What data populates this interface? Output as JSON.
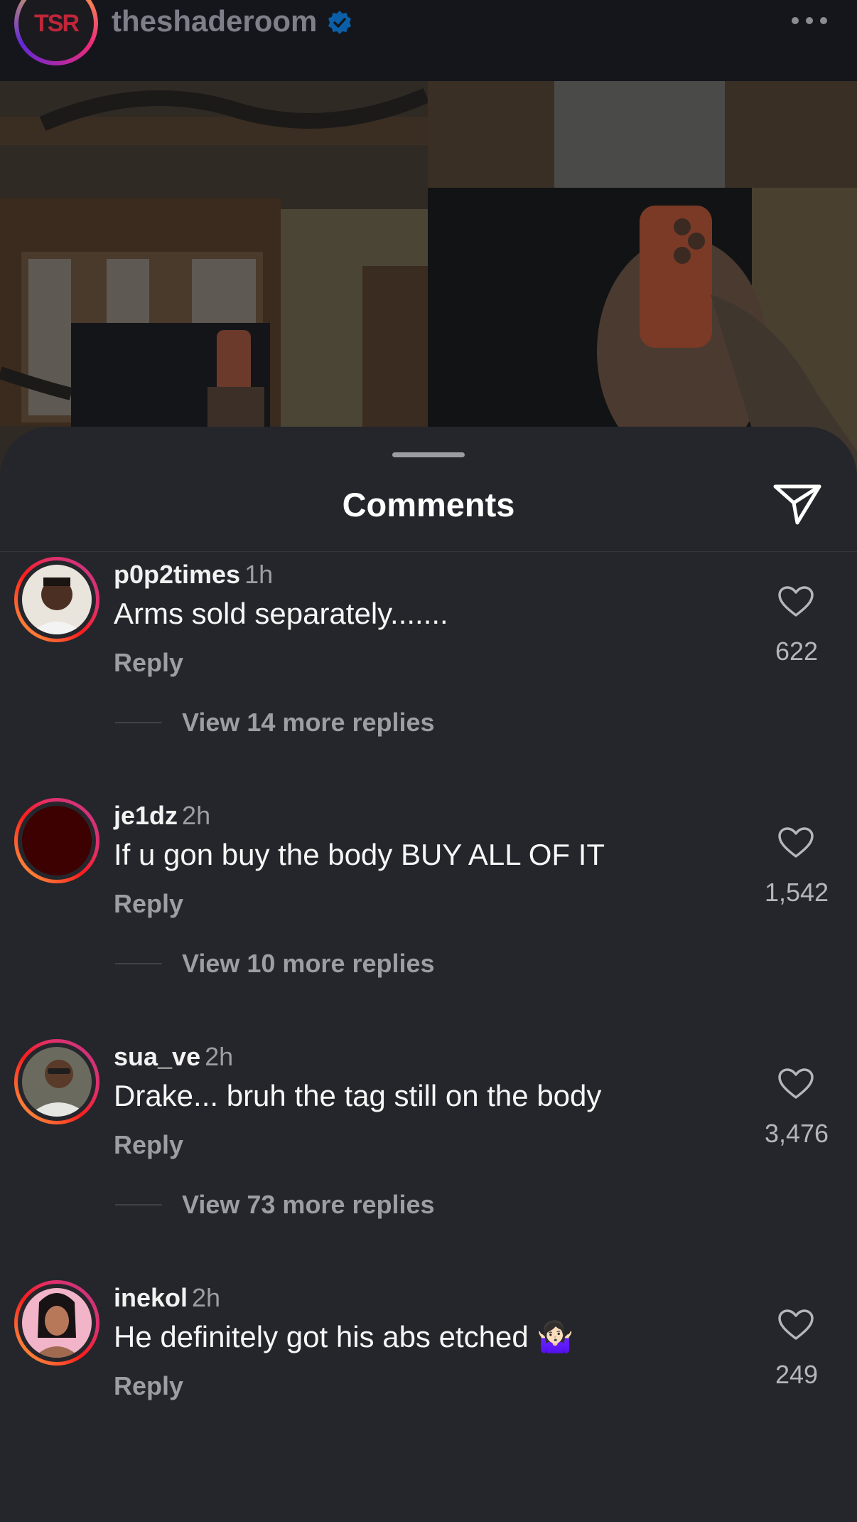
{
  "post": {
    "account_name": "theshaderoom",
    "avatar_text": "TSR",
    "verified": true,
    "more_icon": "more-horizontal-icon"
  },
  "comments_sheet": {
    "title": "Comments",
    "share_icon": "send-paper-plane-icon",
    "reply_label": "Reply",
    "items": [
      {
        "username": "p0p2times",
        "time": "1h",
        "text": "Arms sold separately.......",
        "likes": "622",
        "view_replies": "View 14 more replies"
      },
      {
        "username": "je1dz",
        "time": "2h",
        "text": "If u gon buy the body BUY ALL OF IT",
        "likes": "1,542",
        "view_replies": "View 10 more replies"
      },
      {
        "username": "sua_ve",
        "time": "2h",
        "text": "Drake... bruh the tag still on the body",
        "likes": "3,476",
        "view_replies": "View 73 more replies"
      },
      {
        "username": "inekol",
        "time": "2h",
        "text": "He definitely got his abs etched 🤷🏻‍♀️",
        "likes": "249",
        "view_replies": ""
      }
    ]
  },
  "colors": {
    "background": "#25262b",
    "header": "#14161b",
    "verified_blue": "#0095f6",
    "muted_text": "#9c9ea4"
  }
}
